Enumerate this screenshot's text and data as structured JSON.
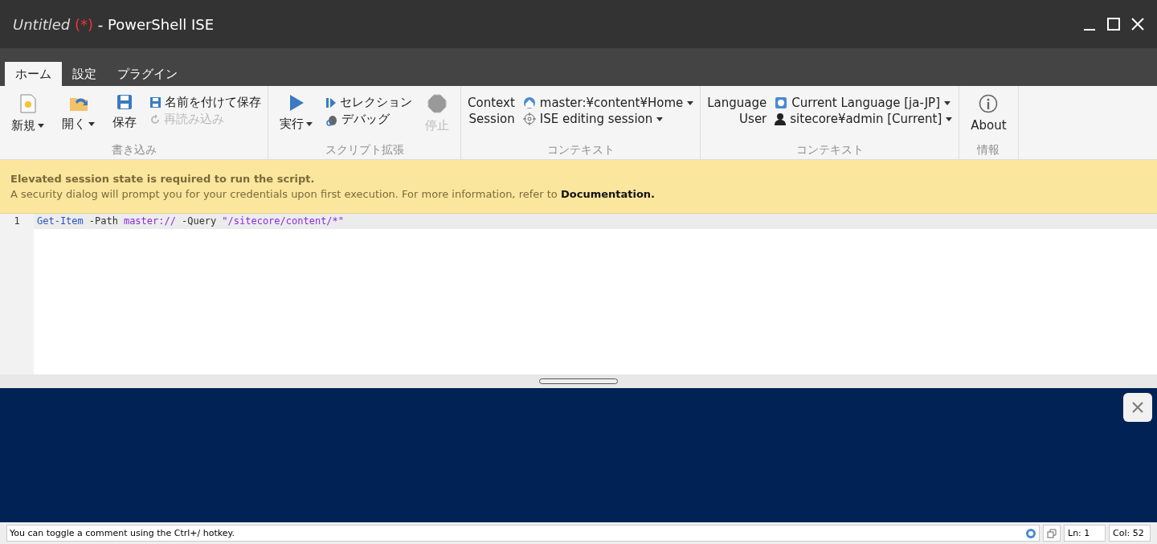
{
  "window": {
    "title": "Untitled",
    "modified_mark": "(*)",
    "app": "- PowerShell ISE"
  },
  "tabs": [
    {
      "label": "ホーム",
      "selected": true
    },
    {
      "label": "設定",
      "selected": false
    },
    {
      "label": "プラグイン",
      "selected": false
    }
  ],
  "ribbon": {
    "groups": [
      {
        "caption": "書き込み",
        "items": [
          {
            "kind": "large",
            "label": "新規",
            "dropdown": true,
            "disabled": false
          },
          {
            "kind": "large",
            "label": "開く",
            "dropdown": true,
            "disabled": false
          },
          {
            "kind": "large",
            "label": "保存",
            "dropdown": false,
            "disabled": false
          },
          {
            "kind": "stack",
            "entries": [
              {
                "label": "名前を付けて保存",
                "disabled": false
              },
              {
                "label": "再読み込み",
                "disabled": true
              }
            ]
          }
        ]
      },
      {
        "caption": "スクリプト拡張",
        "items": [
          {
            "kind": "large",
            "label": "実行",
            "dropdown": true,
            "disabled": false
          },
          {
            "kind": "stack",
            "entries": [
              {
                "label": "セレクション",
                "disabled": false
              },
              {
                "label": "デバッグ",
                "disabled": false
              }
            ]
          },
          {
            "kind": "large",
            "label": "停止",
            "dropdown": false,
            "disabled": true
          }
        ]
      },
      {
        "caption": "コンテキスト",
        "items": [
          {
            "kind": "context",
            "rows": [
              {
                "label": "Context",
                "value": "master:¥content¥Home"
              },
              {
                "label": "Session",
                "value": "ISE editing session"
              }
            ]
          }
        ]
      },
      {
        "caption": "コンテキスト",
        "items": [
          {
            "kind": "context",
            "rows": [
              {
                "label": "Language",
                "value": "Current Language [ja-JP]"
              },
              {
                "label": "User",
                "value": "sitecore¥admin [Current]"
              }
            ]
          }
        ]
      },
      {
        "caption": "情報",
        "items": [
          {
            "kind": "large",
            "label": "About",
            "dropdown": false,
            "disabled": false
          }
        ]
      }
    ]
  },
  "banner": {
    "title": "Elevated session state is required to run the script.",
    "message": "A security dialog will prompt you for your credentials upon first execution. For more information, refer to",
    "link": "Documentation."
  },
  "editor": {
    "lines": [
      {
        "number": "1",
        "tokens": [
          {
            "kind": "command",
            "text": "Get-Item"
          },
          {
            "kind": "parameter",
            "text": "-Path"
          },
          {
            "kind": "drive",
            "text": "master://"
          },
          {
            "kind": "parameter",
            "text": "-Query"
          },
          {
            "kind": "string",
            "text": "\"/sitecore/content/*\""
          }
        ]
      }
    ]
  },
  "status_bar": {
    "message": "You can toggle a comment using the Ctrl+/ hotkey.",
    "line": "Ln: 1",
    "column": "Col: 52"
  }
}
